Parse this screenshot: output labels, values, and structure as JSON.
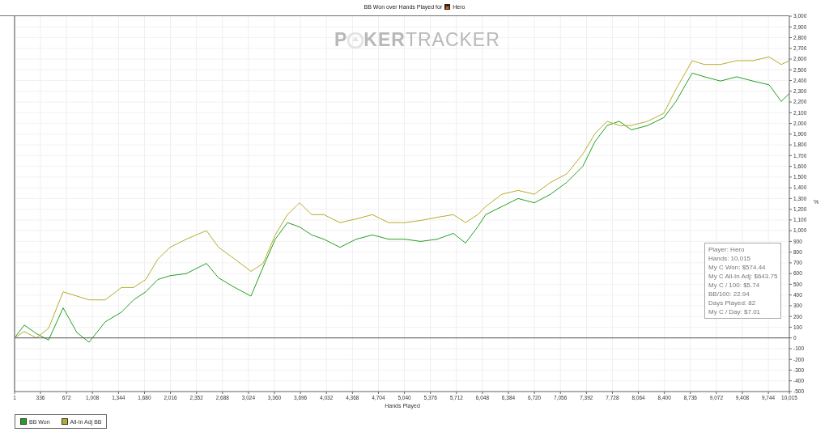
{
  "title": {
    "text": "BB Won over Hands Played for",
    "player": "Hero"
  },
  "logo": {
    "first": "P",
    "rest": "KER",
    "second": "TRACKER"
  },
  "chart_data": {
    "type": "line",
    "grid": true,
    "xlabel": "Hands Played",
    "ylabel": "%",
    "xlim": [
      1,
      10015
    ],
    "ylim": [
      -500,
      3000
    ],
    "x": [
      1,
      127,
      284,
      440,
      629,
      807,
      964,
      1173,
      1382,
      1539,
      1696,
      1853,
      2010,
      2219,
      2481,
      2638,
      2847,
      3056,
      3213,
      3370,
      3527,
      3684,
      3841,
      3998,
      4207,
      4416,
      4626,
      4835,
      5044,
      5253,
      5463,
      5672,
      5829,
      5986,
      6090,
      6300,
      6509,
      6719,
      6928,
      7137,
      7346,
      7503,
      7660,
      7817,
      7974,
      8184,
      8393,
      8550,
      8760,
      8916,
      9125,
      9334,
      9544,
      9753,
      9910,
      10015
    ],
    "series": [
      {
        "name": "BB Won",
        "color": "#22a022",
        "values": [
          0,
          120,
          40,
          -20,
          280,
          50,
          -40,
          150,
          240,
          355,
          430,
          545,
          580,
          600,
          695,
          560,
          470,
          390,
          660,
          920,
          1075,
          1035,
          960,
          920,
          845,
          920,
          960,
          920,
          920,
          900,
          920,
          975,
          885,
          1035,
          1150,
          1225,
          1300,
          1260,
          1340,
          1450,
          1600,
          1830,
          1980,
          2020,
          1940,
          1980,
          2055,
          2205,
          2470,
          2435,
          2395,
          2435,
          2395,
          2360,
          2205,
          2280
        ]
      },
      {
        "name": "All-In Adj BB",
        "color": "#b5ad2a",
        "values": [
          0,
          60,
          0,
          90,
          430,
          390,
          355,
          355,
          470,
          470,
          545,
          735,
          845,
          920,
          1000,
          845,
          735,
          620,
          695,
          960,
          1150,
          1260,
          1150,
          1150,
          1075,
          1110,
          1150,
          1075,
          1075,
          1095,
          1125,
          1150,
          1075,
          1150,
          1225,
          1340,
          1375,
          1340,
          1450,
          1530,
          1715,
          1905,
          2020,
          1980,
          1980,
          2020,
          2095,
          2320,
          2585,
          2550,
          2550,
          2585,
          2585,
          2620,
          2550,
          2585
        ]
      }
    ],
    "xticks": [
      1,
      {
        "value": 336,
        "label": "336"
      },
      {
        "value": 672,
        "label": "672"
      },
      {
        "value": 1008,
        "label": "1,008"
      },
      {
        "value": 1344,
        "label": "1,344"
      },
      {
        "value": 1680,
        "label": "1,680"
      },
      {
        "value": 2016,
        "label": "2,016"
      },
      {
        "value": 2352,
        "label": "2,352"
      },
      {
        "value": 2688,
        "label": "2,688"
      },
      {
        "value": 3024,
        "label": "3,024"
      },
      {
        "value": 3360,
        "label": "3,360"
      },
      {
        "value": 3696,
        "label": "3,696"
      },
      {
        "value": 4032,
        "label": "4,032"
      },
      {
        "value": 4368,
        "label": "4,368"
      },
      {
        "value": 4704,
        "label": "4,704"
      },
      {
        "value": 5040,
        "label": "5,040"
      },
      {
        "value": 5376,
        "label": "5,376"
      },
      {
        "value": 5712,
        "label": "5,712"
      },
      {
        "value": 6048,
        "label": "6,048"
      },
      {
        "value": 6384,
        "label": "6,384"
      },
      {
        "value": 6720,
        "label": "6,720"
      },
      {
        "value": 7056,
        "label": "7,056"
      },
      {
        "value": 7392,
        "label": "7,392"
      },
      {
        "value": 7728,
        "label": "7,728"
      },
      {
        "value": 8064,
        "label": "8,064"
      },
      {
        "value": 8400,
        "label": "8,400"
      },
      {
        "value": 8736,
        "label": "8,736"
      },
      {
        "value": 9072,
        "label": "9,072"
      },
      {
        "value": 9408,
        "label": "9,408"
      },
      {
        "value": 9744,
        "label": "9,744"
      },
      {
        "value": 10015,
        "label": "10,015"
      }
    ],
    "yticks": [
      {
        "value": -500,
        "label": "-500"
      },
      {
        "value": -400,
        "label": "-400"
      },
      {
        "value": -300,
        "label": "-300"
      },
      {
        "value": -200,
        "label": "-200"
      },
      {
        "value": -100,
        "label": "-100"
      },
      {
        "value": 0,
        "label": "0"
      },
      {
        "value": 100,
        "label": "100"
      },
      {
        "value": 200,
        "label": "200"
      },
      {
        "value": 300,
        "label": "300"
      },
      {
        "value": 400,
        "label": "400"
      },
      {
        "value": 500,
        "label": "500"
      },
      {
        "value": 600,
        "label": "600"
      },
      {
        "value": 700,
        "label": "700"
      },
      {
        "value": 800,
        "label": "800"
      },
      {
        "value": 900,
        "label": "900"
      },
      {
        "value": 1000,
        "label": "1,000"
      },
      {
        "value": 1100,
        "label": "1,100"
      },
      {
        "value": 1200,
        "label": "1,200"
      },
      {
        "value": 1300,
        "label": "1,300"
      },
      {
        "value": 1400,
        "label": "1,400"
      },
      {
        "value": 1500,
        "label": "1,500"
      },
      {
        "value": 1600,
        "label": "1,600"
      },
      {
        "value": 1700,
        "label": "1,700"
      },
      {
        "value": 1800,
        "label": "1,800"
      },
      {
        "value": 1900,
        "label": "1,900"
      },
      {
        "value": 2000,
        "label": "2,000"
      },
      {
        "value": 2100,
        "label": "2,100"
      },
      {
        "value": 2200,
        "label": "2,200"
      },
      {
        "value": 2300,
        "label": "2,300"
      },
      {
        "value": 2400,
        "label": "2,400"
      },
      {
        "value": 2500,
        "label": "2,500"
      },
      {
        "value": 2600,
        "label": "2,600"
      },
      {
        "value": 2700,
        "label": "2,700"
      },
      {
        "value": 2800,
        "label": "2,800"
      },
      {
        "value": 2900,
        "label": "2,900"
      },
      {
        "value": 3000,
        "label": "3,000"
      }
    ]
  },
  "stats": [
    "Player: Hero",
    "Hands: 10,015",
    "My C Won: $574.44",
    "My C All-In Adj: $643.75",
    "My C / 100: $5.74",
    "BB/100: 22.94",
    "Days Played: 82",
    "My C / Day: $7.01"
  ]
}
